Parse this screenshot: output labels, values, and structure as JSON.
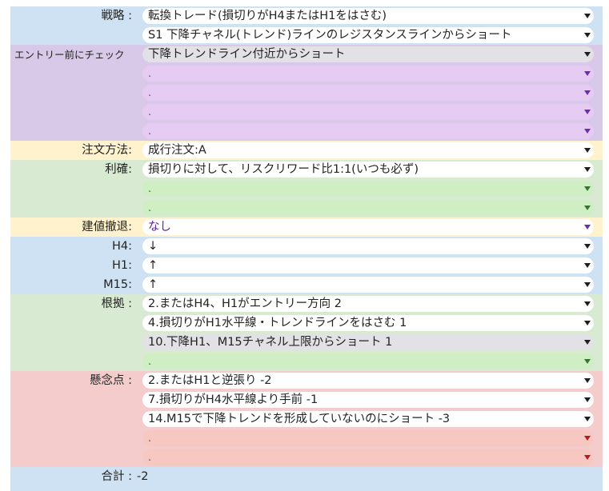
{
  "colors": {
    "blue": "#cfe2f3",
    "purple": "#d8c9e8",
    "yellow": "#fff2cc",
    "green": "#d9ead3",
    "red": "#f4cccc",
    "dropdown_white": "#ffffff",
    "dropdown_gray": "#e2e2e6",
    "dropdown_lavender": "#e6cbf3",
    "dropdown_lightgreen": "#cfeec3",
    "dropdown_pink": "#f7c7c2"
  },
  "strategy": {
    "label": "戦略 :",
    "values": [
      "転換トレード(損切りがH4またはH1をはさむ)",
      "S1 下降チャネル(トレンド)ラインのレジスタンスラインからショート"
    ]
  },
  "pre_entry": {
    "label": "エントリー前にチェック",
    "values": [
      "下降トレンドライン付近からショート",
      ".",
      ".",
      ".",
      "."
    ]
  },
  "order_method": {
    "label": "注文方法:",
    "value": "成行注文:A"
  },
  "take_profit": {
    "label": "利確:",
    "values": [
      "損切りに対して、リスクリワード比1:1(いつも必ず)",
      ".",
      "."
    ]
  },
  "withdrawal": {
    "label": "建値撤退:",
    "value": "なし"
  },
  "timeframes": {
    "h4_label": "H4:",
    "h4_value": "↓",
    "h1_label": "H1:",
    "h1_value": "↑",
    "m15_label": "M15:",
    "m15_value": "↑"
  },
  "basis": {
    "label": "根拠 :",
    "values": [
      "2.またはH4、H1がエントリー方向  2",
      "4.損切りがH1水平線・トレンドラインをはさむ  1",
      "10.下降H1、M15チャネル上限からショート  1",
      "."
    ]
  },
  "concerns": {
    "label": "懸念点 :",
    "values": [
      "2.またはH1と逆張り  -2",
      "7.損切りがH4水平線より手前  -1",
      "14.M15で下降トレンドを形成していないのにショート  -3",
      ".",
      "."
    ]
  },
  "total": {
    "label": "合計 :",
    "value": "-2"
  },
  "icons": {
    "dropdown": "chevron-down-icon"
  }
}
